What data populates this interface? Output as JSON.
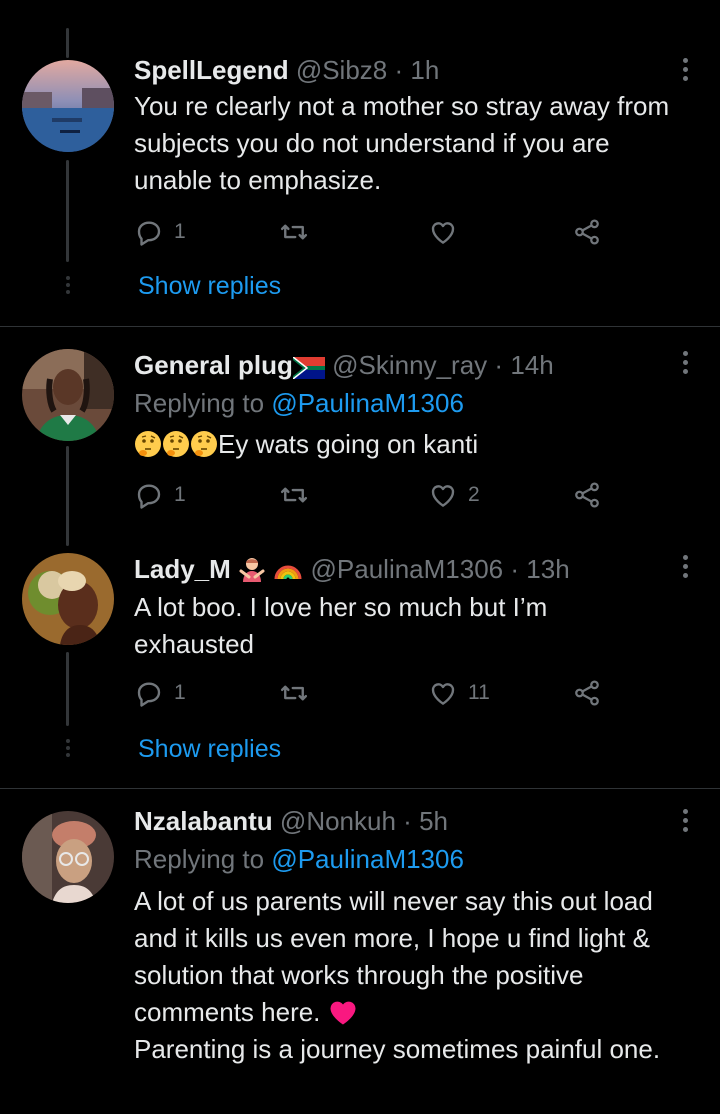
{
  "colors": {
    "background": "#000000",
    "text": "#e7e9ea",
    "secondary": "#71767b",
    "link": "#1d9bf0",
    "divider": "#2f3336",
    "heart": "#f91880"
  },
  "tweets": [
    {
      "name": "SpellLegend",
      "handle": "@Sibz8",
      "separator": "·",
      "time": "1h",
      "text": [
        "You re clearly not a mother so stray away from subjects you do not understand if you are unable to emphasize."
      ],
      "reply_count": "1",
      "like_count": "",
      "show_replies": "Show replies",
      "avatar": "venice-canal-photo"
    },
    {
      "name": "General plug",
      "name_emoji": "south-africa-flag",
      "handle": "@Skinny_ray",
      "separator": "·",
      "time": "14h",
      "replying_prefix": "Replying to",
      "replying_to": "@PaulinaM1306",
      "text": [
        "Ey wats going on kanti"
      ],
      "text_emoji": [
        "thinking-face",
        "thinking-face",
        "thinking-face"
      ],
      "reply_count": "1",
      "like_count": "2",
      "avatar": "man-with-dreadlocks-photo"
    },
    {
      "name": "Lady_M",
      "name_emoji": [
        "person-gesturing-no",
        "rainbow"
      ],
      "handle": "@PaulinaM1306",
      "separator": "·",
      "time": "13h",
      "text": [
        "A lot boo. I love her so much but I’m exhausted"
      ],
      "reply_count": "1",
      "like_count": "11",
      "show_replies": "Show replies",
      "avatar": "woman-illustration"
    },
    {
      "name": "Nzalabantu",
      "handle": "@Nonkuh",
      "separator": "·",
      "time": "5h",
      "replying_prefix": "Replying to",
      "replying_to": "@PaulinaM1306",
      "text": [
        "A lot of us parents will never say this out load and it kills us even more, I hope u find light & solution that works through the positive comments here.",
        "Parenting is a journey sometimes painful one."
      ],
      "text_emoji": [
        "red-heart"
      ],
      "avatar": "woman-with-glasses-photo"
    }
  ]
}
